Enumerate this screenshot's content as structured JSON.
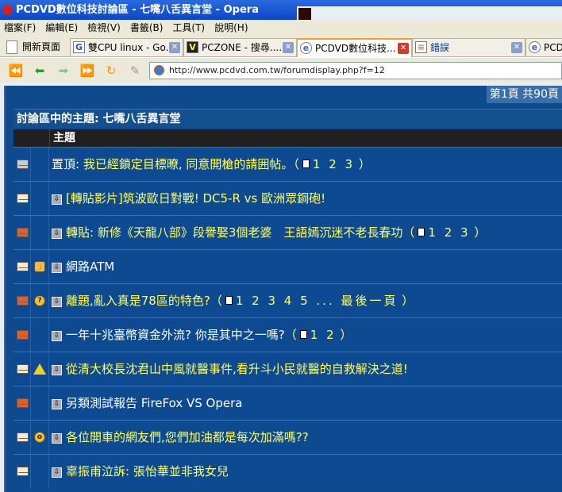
{
  "window": {
    "title": "PCDVD數位科技討論區 - 七嘴八舌異言堂 - Opera"
  },
  "menu": [
    "檔案(F)",
    "編輯(E)",
    "檢視(V)",
    "書籤(B)",
    "工具(T)",
    "說明(H)"
  ],
  "new_tab": "開新頁面",
  "tabs": [
    {
      "label": "雙CPU linux - Go...",
      "icon": "G"
    },
    {
      "label": "PCZONE - 搜尋......",
      "icon": "V"
    },
    {
      "label": "PCDVD數位科技...",
      "icon": "opera"
    },
    {
      "label": "錯誤",
      "icon": "doc"
    },
    {
      "label": "PCDV",
      "icon": "opera"
    }
  ],
  "address": "http://www.pcdvd.com.tw/forumdisplay.php?f=12",
  "pager": "第1頁 共90頁",
  "forum_title": "討論區中的主題: 七嘴八舌異言堂",
  "table_header": "主題",
  "threads": [
    {
      "status": "locked",
      "emoticon": "",
      "prefix": "置頂: ",
      "title": "我已經鎖定目標暸, 同意開槍的請囲帖。",
      "pages": "1 2 3",
      "color": "yellow",
      "dl": false
    },
    {
      "status": "normal",
      "emoticon": "",
      "prefix": "",
      "title": "[轉貼影片]筑波歐日對戰! DC5-R vs 歐洲眾鋼砲!",
      "pages": "",
      "color": "yellow",
      "dl": true
    },
    {
      "status": "hot",
      "emoticon": "",
      "prefix": "",
      "title": "轉貼: 新修《天龍八部》段譽娶3個老婆　王語嫣沉迷不老長春功",
      "pages": "1 2 3",
      "color": "yellow",
      "dl": true
    },
    {
      "status": "normal",
      "emoticon": "thumb",
      "prefix": "",
      "title": "網路ATM",
      "pages": "",
      "color": "white",
      "dl": true
    },
    {
      "status": "hot",
      "emoticon": "question",
      "prefix": "",
      "title": "離題,亂入真是78區的特色?",
      "pages": "1 2 3 4 5 ... 最後一頁",
      "color": "yellow",
      "dl": true
    },
    {
      "status": "hot",
      "emoticon": "",
      "prefix": "",
      "title": "一年十兆臺幣資金外流? 你是其中之一嗎?",
      "pages": "1 2",
      "color": "white",
      "dl": true
    },
    {
      "status": "normal",
      "emoticon": "warn",
      "prefix": "",
      "title": "從清大校長沈君山中風就醫事件,看升斗小民就醫的自救解決之道!",
      "pages": "",
      "color": "yellow",
      "dl": true
    },
    {
      "status": "hot",
      "emoticon": "",
      "prefix": "",
      "title": "另類測試報告 FireFox VS Opera",
      "pages": "",
      "color": "white",
      "dl": true
    },
    {
      "status": "normal",
      "emoticon": "surprised",
      "prefix": "",
      "title": "各位開車的網友們,您們加油都是每次加滿嗎??",
      "pages": "",
      "color": "yellow",
      "dl": true
    },
    {
      "status": "normal",
      "emoticon": "",
      "prefix": "",
      "title": "辜振甫泣訴: 張怡華並非我女兒",
      "pages": "",
      "color": "yellow",
      "dl": true
    }
  ]
}
